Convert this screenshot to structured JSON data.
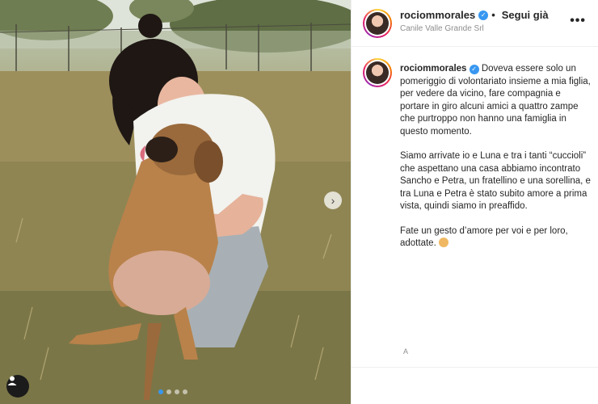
{
  "header": {
    "username": "rociommorales",
    "separator": "•",
    "follow_label": "Segui già",
    "location": "Canile Valle Grande Srl",
    "more_label": "•••"
  },
  "caption": {
    "username": "rociommorales",
    "paragraph1": "Doveva essere solo un pomeriggio di volontariato insieme a mia figlia, per vedere da vicino, fare compagnia e portare in giro alcuni amici a quattro zampe che purtroppo non hanno una famiglia in questo momento.",
    "paragraph2": "Siamo arrivate io e Luna e tra i tanti “cuccioli” che aspettano una casa abbiamo incontrato Sancho e Petra, un fratellino e una sorellina, e tra Luna e Petra è stato subito amore a prima vista, quindi siamo in preaffido.",
    "paragraph3": "Fate un gesto d’amore per voi e per loro, adottate."
  },
  "footer_mark": "A",
  "photo": {
    "next_arrow": "›",
    "carousel_total": 4,
    "carousel_active": 1
  },
  "colors": {
    "verified": "#3897f0",
    "text": "#262626",
    "muted": "#8e8e8e"
  },
  "icons": {
    "verified": "verified-badge-icon",
    "more": "more-options-icon",
    "next": "chevron-right-icon",
    "user_tag": "user-tag-icon"
  }
}
